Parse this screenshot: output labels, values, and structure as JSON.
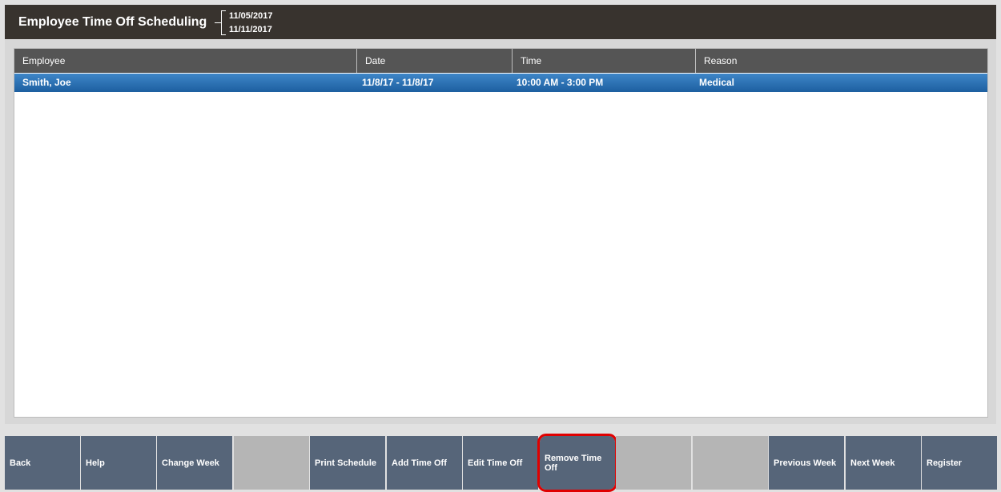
{
  "header": {
    "title": "Employee Time Off Scheduling",
    "start_date": "11/05/2017",
    "end_date": "11/11/2017"
  },
  "grid": {
    "columns": [
      "Employee",
      "Date",
      "Time",
      "Reason"
    ],
    "rows": [
      {
        "employee": "Smith, Joe",
        "date": "11/8/17 - 11/8/17",
        "time": "10:00 AM - 3:00 PM",
        "reason": "Medical"
      }
    ]
  },
  "toolbar": {
    "buttons": [
      "Back",
      "Help",
      "Change Week",
      "",
      "Print Schedule",
      "Add Time Off",
      "Edit Time Off",
      "Remove Time Off",
      "",
      "",
      "Previous Week",
      "Next Week",
      "Register"
    ],
    "highlighted": "Remove Time Off"
  },
  "colors": {
    "header_bg": "#38332e",
    "selected_row": "#2a6fb2",
    "button_bg": "#566579",
    "empty_button_bg": "#b5b5b5",
    "highlight_outline": "#e00000"
  }
}
